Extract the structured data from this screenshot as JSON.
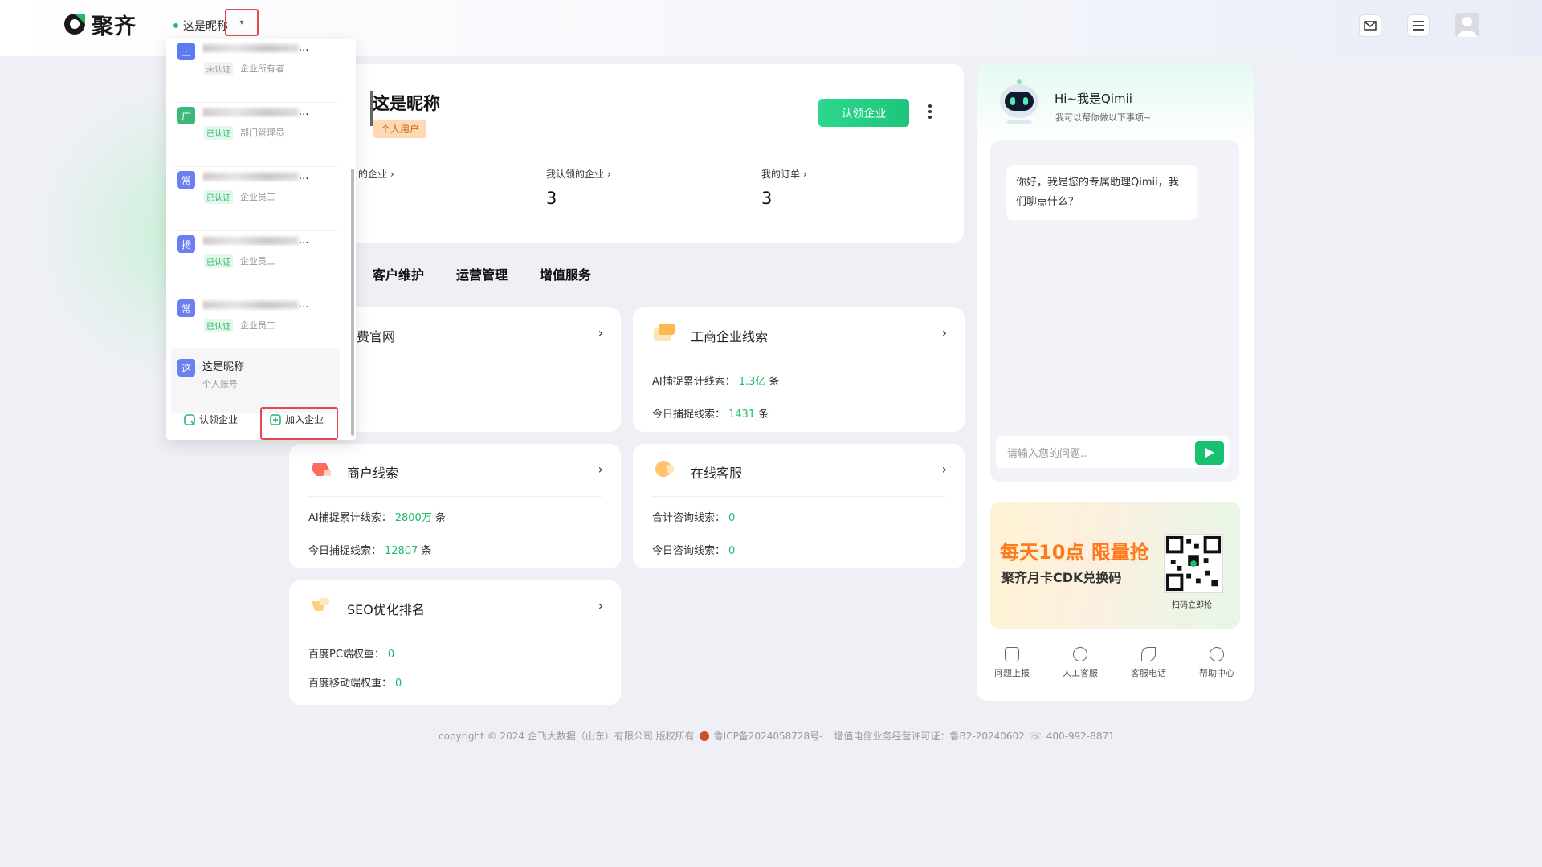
{
  "app": {
    "logo_text": "聚齐"
  },
  "header": {
    "account_name": "这是昵称"
  },
  "profile": {
    "name": "这是昵称",
    "tag": "个人用户",
    "claim_button": "认领企业",
    "stats": [
      {
        "label": "的企业",
        "value": ""
      },
      {
        "label": "我认领的企业",
        "value": "3"
      },
      {
        "label": "我的订单",
        "value": "3"
      }
    ]
  },
  "tabs": [
    "客户维护",
    "运营管理",
    "增值服务"
  ],
  "services": {
    "official_site": {
      "title": "费官网"
    },
    "business_leads": {
      "title": "工商企业线索",
      "r1_label": "AI捕捉累计线索：",
      "r1_value": "1.3亿",
      "r1_unit": "条",
      "r2_label": "今日捕捉线索：",
      "r2_value": "1431",
      "r2_unit": "条"
    },
    "merchant_leads": {
      "title": "商户线索",
      "r1_label": "AI捕捉累计线索：",
      "r1_value": "2800万",
      "r1_unit": "条",
      "r2_label": "今日捕捉线索：",
      "r2_value": "12807",
      "r2_unit": "条"
    },
    "online_service": {
      "title": "在线客服",
      "r1_label": "合计咨询线索：",
      "r1_value": "0",
      "r2_label": "今日咨询线索：",
      "r2_value": "0"
    },
    "seo": {
      "title": "SEO优化排名",
      "r1_label": "百度PC端权重：",
      "r1_value": "0",
      "r2_label": "百度移动端权重：",
      "r2_value": "0"
    }
  },
  "assistant": {
    "title": "Hi~我是Qimii",
    "subtitle": "我可以帮你做以下事项~",
    "greeting": "你好，我是您的专属助理Qimii，我们聊点什么？",
    "input_placeholder": "请输入您的问题..",
    "promo_line1": "每天10点 限量抢",
    "promo_line2": "聚齐月卡CDK兑换码",
    "promo_qr_caption": "扫码立即抢",
    "bottom_links": [
      "问题上报",
      "人工客服",
      "客服电话",
      "帮助中心"
    ]
  },
  "dropdown": {
    "entries": [
      {
        "avatar": "上",
        "name_suffix": "...",
        "status": "未认证",
        "role": "企业所有者",
        "color": "#5b7cf0"
      },
      {
        "avatar": "广",
        "name_suffix": "...",
        "status": "已认证",
        "role": "部门管理员",
        "color": "#3cb878"
      },
      {
        "avatar": "常",
        "name_suffix": "...",
        "status": "已认证",
        "role": "企业员工",
        "color": "#6b7ff2"
      },
      {
        "avatar": "扬",
        "name_suffix": "...",
        "status": "已认证",
        "role": "企业员工",
        "color": "#6b7ff2"
      },
      {
        "avatar": "常",
        "name_suffix": "...",
        "status": "已认证",
        "role": "企业员工",
        "color": "#6b7ff2"
      }
    ],
    "personal": {
      "avatar": "这",
      "name": "这是昵称",
      "sub": "个人账号"
    },
    "claim_label": "认领企业",
    "join_label": "加入企业"
  },
  "footer": {
    "copyright": "copyright © 2024 企飞大数据（山东）有限公司 版权所有",
    "icp": "鲁ICP备2024058728号-",
    "license": "增值电信业务经营许可证：鲁B2-20240602",
    "phone": "400-992-8871"
  }
}
